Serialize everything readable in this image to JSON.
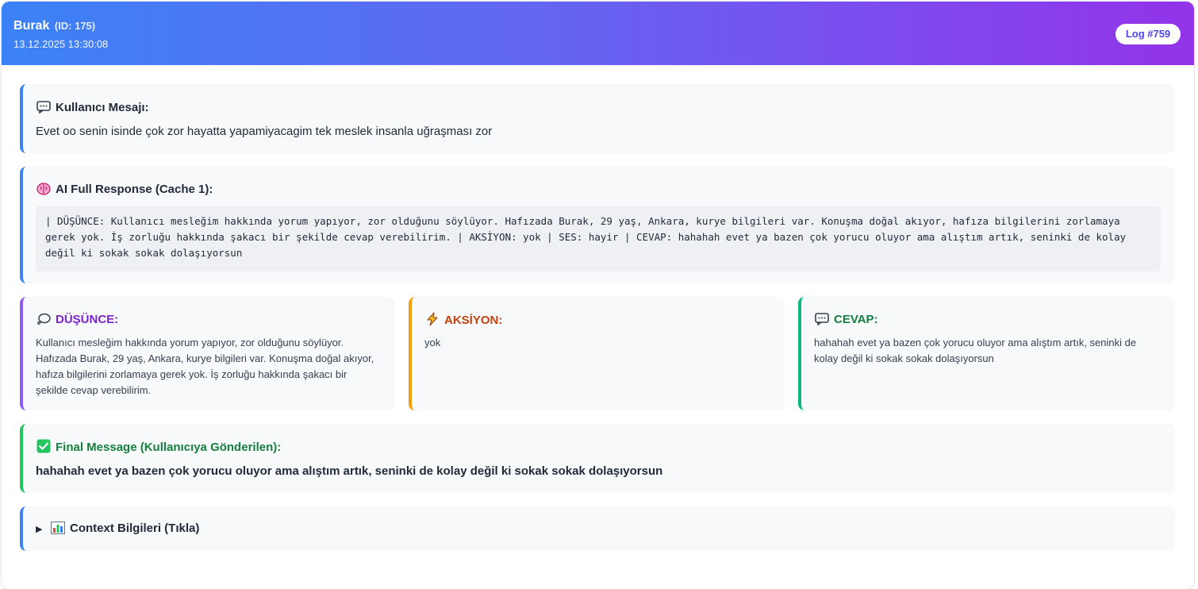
{
  "header": {
    "name": "Burak",
    "id_label": "(ID: 175)",
    "timestamp": "13.12.2025 13:30:08",
    "log_badge": "Log #759"
  },
  "user_message": {
    "icon": "speech-bubble-icon",
    "title": "Kullanıcı Mesajı:",
    "text": "Evet oo senin isinde çok zor hayatta yapamiyacagim tek meslek insanla uğraşması zor"
  },
  "ai_response": {
    "icon": "brain-icon",
    "title": "AI Full Response (Cache 1):",
    "text": "| DÜŞÜNCE: Kullanıcı mesleğim hakkında yorum yapıyor, zor olduğunu söylüyor. Hafızada Burak, 29 yaş, Ankara, kurye bilgileri var. Konuşma doğal akıyor, hafıza bilgilerini zorlamaya gerek yok. İş zorluğu hakkında şakacı bir şekilde cevap verebilirim. | AKSİYON: yok | SES: hayir | CEVAP: hahahah evet ya bazen çok yorucu oluyor ama alıştım artık, seninki de kolay değil ki sokak sokak dolaşıyorsun"
  },
  "thought": {
    "icon": "thought-bubble-icon",
    "title": "DÜŞÜNCE:",
    "text": "Kullanıcı mesleğim hakkında yorum yapıyor, zor olduğunu söylüyor. Hafızada Burak, 29 yaş, Ankara, kurye bilgileri var. Konuşma doğal akıyor, hafıza bilgilerini zorlamaya gerek yok. İş zorluğu hakkında şakacı bir şekilde cevap verebilirim.",
    "color": "#7e22ce",
    "border": "#8b5cf6"
  },
  "action": {
    "icon": "lightning-icon",
    "title": "AKSİYON:",
    "text": "yok",
    "color": "#c2410c",
    "border": "#f59e0b"
  },
  "reply": {
    "icon": "speech-bubble-icon",
    "title": "CEVAP:",
    "text": "hahahah evet ya bazen çok yorucu oluyor ama alıştım artık, seninki de kolay değil ki sokak sokak dolaşıyorsun",
    "color": "#15803d",
    "border": "#10b981"
  },
  "final_message": {
    "icon": "check-mark-icon",
    "title": "Final Message (Kullanıcıya Gönderilen):",
    "text": "hahahah evet ya bazen çok yorucu oluyor ama alıştım artık, seninki de kolay değil ki sokak sokak dolaşıyorsun",
    "color": "#15803d",
    "border": "#22c55e"
  },
  "context": {
    "chevron": "▶",
    "icon": "bar-chart-icon",
    "title": "Context Bilgileri (Tıkla)"
  },
  "colors": {
    "header_gradient_start": "#3b82f6",
    "header_gradient_end": "#9333ea",
    "accent_blue": "#3b82f6"
  }
}
